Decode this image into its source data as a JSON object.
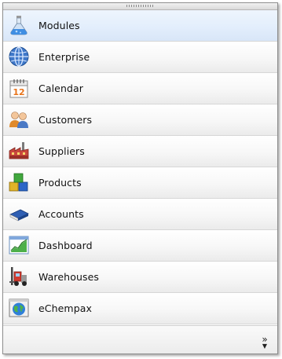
{
  "menu": {
    "items": [
      {
        "label": "Modules",
        "icon": "flask-icon",
        "active": true
      },
      {
        "label": "Enterprise",
        "icon": "globe-icon",
        "active": false
      },
      {
        "label": "Calendar",
        "icon": "calendar-icon",
        "active": false
      },
      {
        "label": "Customers",
        "icon": "users-icon",
        "active": false
      },
      {
        "label": "Suppliers",
        "icon": "factory-icon",
        "active": false
      },
      {
        "label": "Products",
        "icon": "boxes-icon",
        "active": false
      },
      {
        "label": "Accounts",
        "icon": "ledger-book-icon",
        "active": false
      },
      {
        "label": "Dashboard",
        "icon": "chart-icon",
        "active": false
      },
      {
        "label": "Warehouses",
        "icon": "forklift-icon",
        "active": false
      },
      {
        "label": "eChempax",
        "icon": "earth-window-icon",
        "active": false
      }
    ]
  },
  "footer": {
    "more_glyph": "»",
    "more_arrow": "▼",
    "calendar_day": "12"
  },
  "colors": {
    "active_row": "#e3eefc",
    "border": "#8e8e8e"
  }
}
